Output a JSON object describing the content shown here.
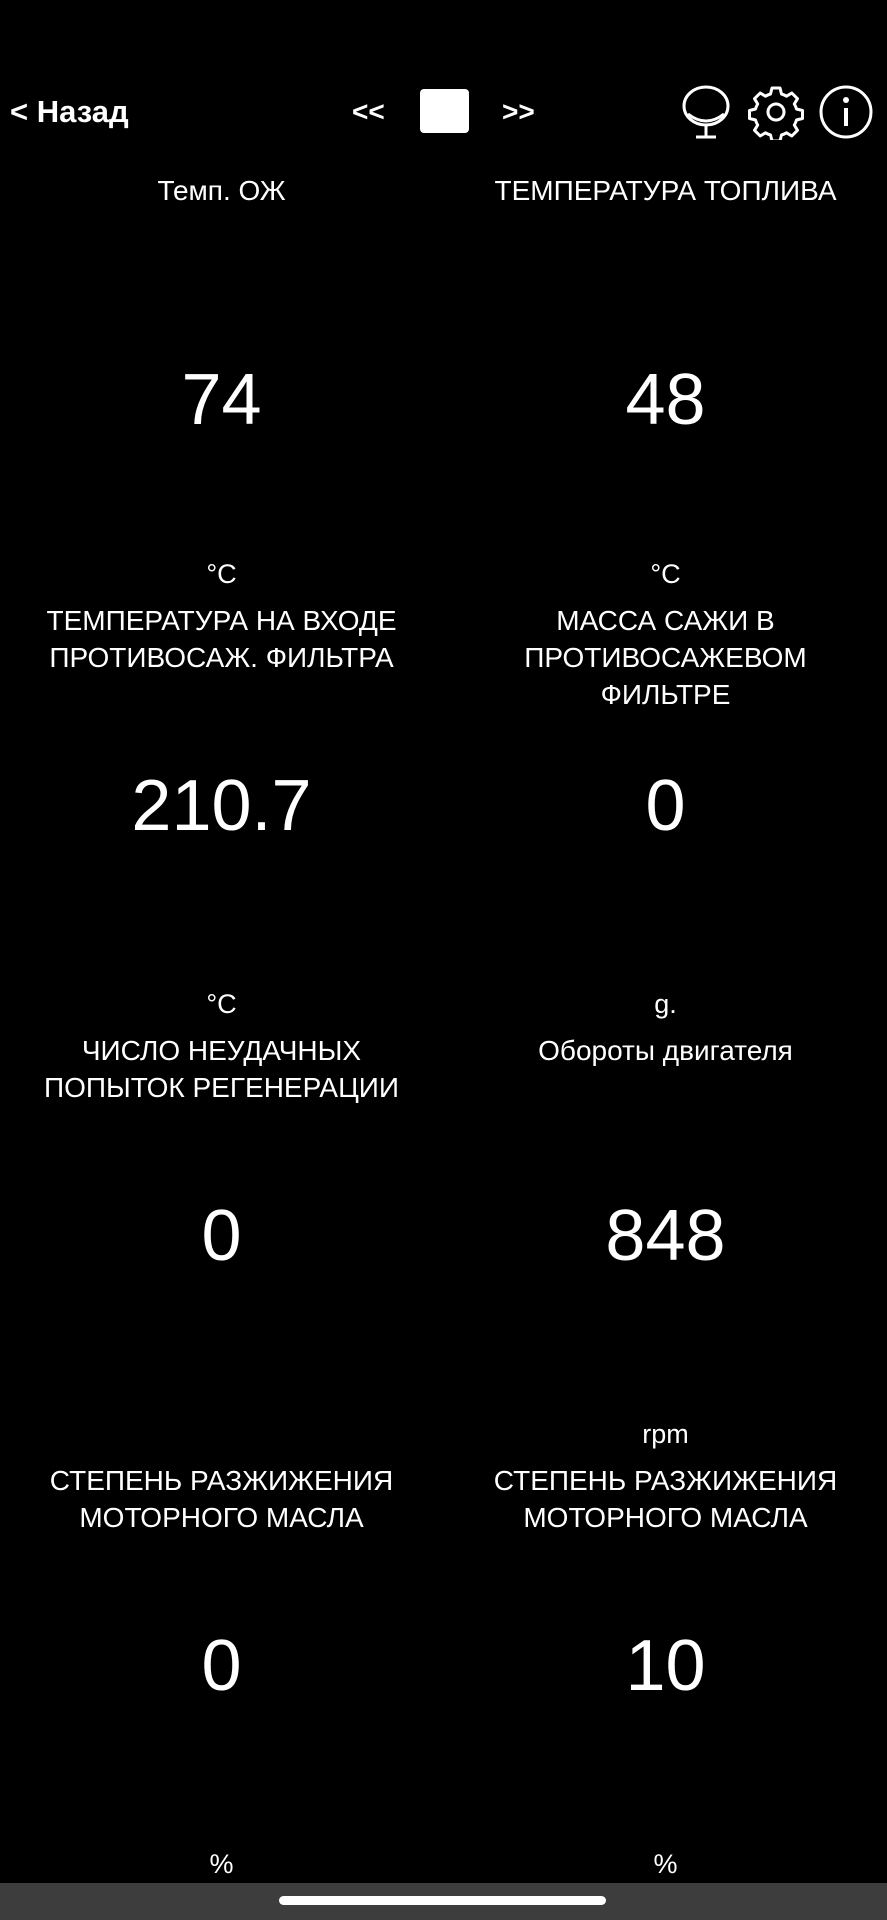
{
  "header": {
    "back_label": "< Назад",
    "prev_label": "<<",
    "next_label": ">>"
  },
  "gauges": [
    {
      "title": "Темп. ОЖ",
      "value": "74",
      "unit": "°C"
    },
    {
      "title": "ТЕМПЕРАТУРА ТОПЛИВА",
      "value": "48",
      "unit": "°C"
    },
    {
      "title": "ТЕМПЕРАТУРА НА ВХОДЕ ПРОТИВОСАЖ. ФИЛЬТРА",
      "value": "210.7",
      "unit": "°C"
    },
    {
      "title": "МАССА САЖИ В ПРОТИВОСАЖЕВОМ ФИЛЬТРЕ",
      "value": "0",
      "unit": "g."
    },
    {
      "title": "ЧИСЛО НЕУДАЧНЫХ ПОПЫТОК РЕГЕНЕРАЦИИ",
      "value": "0",
      "unit": ""
    },
    {
      "title": "Обороты двигателя",
      "value": "848",
      "unit": "rpm"
    },
    {
      "title": "СТЕПЕНЬ РАЗЖИЖЕНИЯ МОТОРНОГО МАСЛА",
      "value": "0",
      "unit": "%"
    },
    {
      "title": "СТЕПЕНЬ РАЗЖИЖЕНИЯ МОТОРНОГО МАСЛА",
      "value": "10",
      "unit": "%"
    }
  ],
  "icons": {
    "mic": "microphone-icon",
    "gear": "gear-icon",
    "info": "info-icon"
  },
  "colors": {
    "background": "#000000",
    "text": "#ffffff",
    "navbar": "#3d3d3d"
  }
}
